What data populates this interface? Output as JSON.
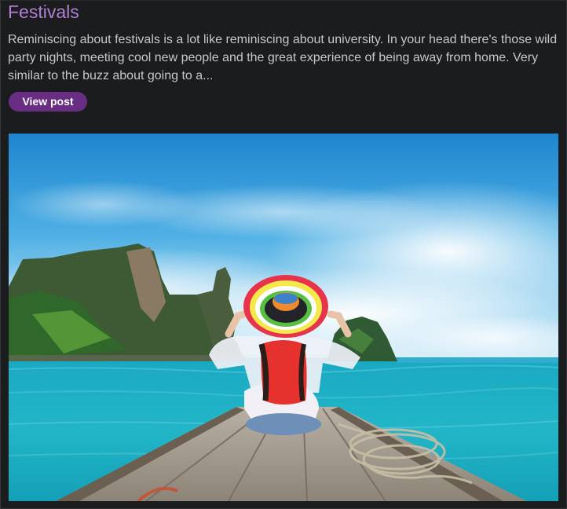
{
  "post": {
    "title": "Festivals",
    "excerpt": "Reminiscing about festivals is a lot like reminiscing about university. In your head there's those wild party nights, meeting cool new people and the great experience of being away from home. Very similar to the buzz about going to a...",
    "view_label": "View post"
  },
  "image": {
    "icon": "travel-photo",
    "colors": {
      "sky": "#3aa3dc",
      "sea": "#1fb1c6",
      "hat_red": "#e8344a",
      "backpack": "#e5322f"
    }
  }
}
